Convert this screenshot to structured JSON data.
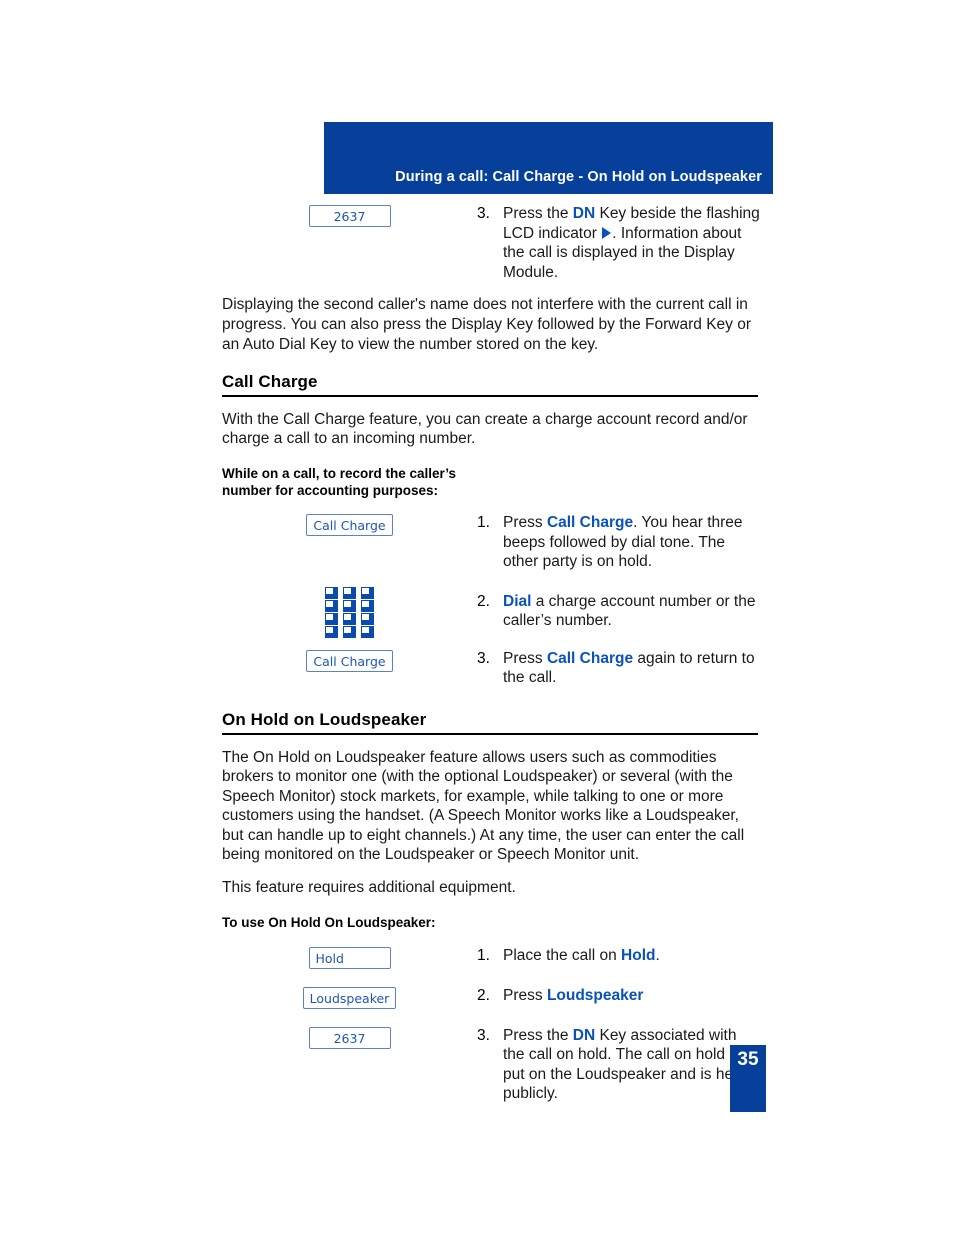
{
  "header": {
    "title": "During a call: Call Charge - On Hold on Loudspeaker",
    "background_color": "#06409b",
    "text_color": "#ffffff"
  },
  "colors": {
    "accent_blue": "#06409b",
    "link_blue": "#0a52bb",
    "key_border": "#5d82c4",
    "key_text": "#1e56b3",
    "body_text": "#1a1a1a"
  },
  "top_step": {
    "key_label": "2637",
    "number": "3.",
    "text_before": "Press the ",
    "bold_1": "DN",
    "text_mid": " Key beside the flashing LCD indicator ",
    "icon": "right-triangle-icon",
    "text_after": ". Information about the call is displayed in the Display Module."
  },
  "intro_paragraph": "Displaying the second caller's name does not interfere with the current call in progress. You can also press the Display Key followed by the Forward Key or an Auto Dial Key to view the number stored on the key.",
  "call_charge_section": {
    "heading": "Call Charge",
    "body": "With the Call Charge feature, you can create a charge account record and/or charge a call to an incoming number.",
    "subheading_line1": "While on a call, to record the caller’s",
    "subheading_line2": "number for accounting purposes:",
    "steps": [
      {
        "key_label": "Call Charge",
        "key_type": "button",
        "number": "1.",
        "text_before": "Press ",
        "bold": "Call Charge",
        "text_after": ". You hear three beeps followed by dial tone. The other party is on hold."
      },
      {
        "key_label": "keypad-icon",
        "key_type": "keypad",
        "number": "2.",
        "text_before": "",
        "bold": "Dial",
        "text_after": " a charge account number or the caller’s number."
      },
      {
        "key_label": "Call Charge",
        "key_type": "button",
        "number": "3.",
        "text_before": "Press ",
        "bold": "Call Charge",
        "text_after": " again to return to the call."
      }
    ]
  },
  "loudspeaker_section": {
    "heading": "On Hold on Loudspeaker",
    "body_1": "The On Hold on Loudspeaker feature allows users such as commodities brokers to monitor one (with the optional Loudspeaker) or several (with the Speech Monitor) stock markets, for example, while talking to one or more customers using the handset. (A Speech Monitor works like a Loudspeaker, but can handle up to eight channels.) At any time, the user can enter the call being monitored on the Loudspeaker or Speech Monitor unit.",
    "body_2": "This feature requires additional equipment.",
    "subheading": "To use On Hold On Loudspeaker:",
    "steps": [
      {
        "key_label": "Hold",
        "key_type": "button",
        "number": "1.",
        "text_before": "Place the call on ",
        "bold": "Hold",
        "text_after": "."
      },
      {
        "key_label": "Loudspeaker",
        "key_type": "button",
        "number": "2.",
        "text_before": "Press ",
        "bold": "Loudspeaker",
        "text_after": ""
      },
      {
        "key_label": "2637",
        "key_type": "button",
        "number": "3.",
        "text_before": "Press the ",
        "bold": "DN",
        "text_after": " Key associated with the call on hold. The call on hold is put on the Loudspeaker and is heard publicly."
      }
    ]
  },
  "page_number": "35"
}
